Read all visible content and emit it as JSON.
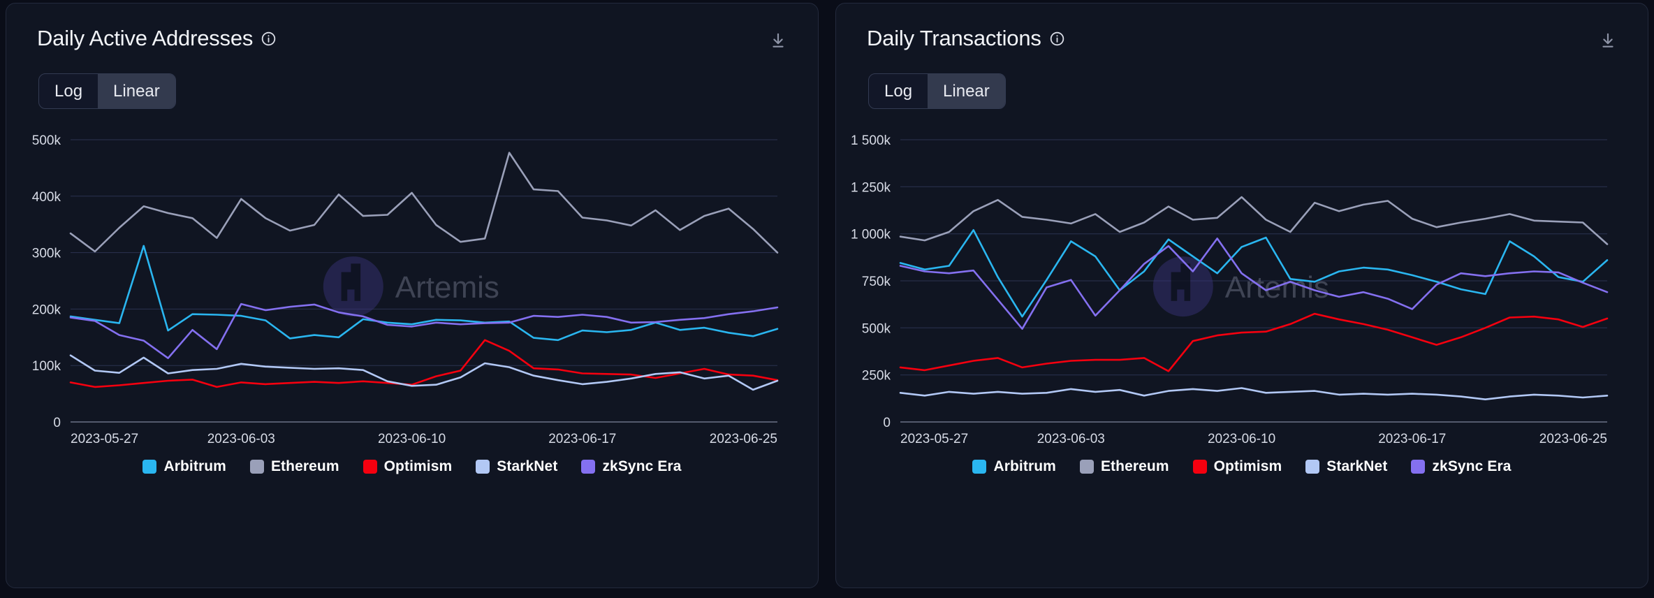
{
  "theme": {
    "page_bg": "#0a0d18",
    "card_bg": "#101522",
    "card_border": "#232a3d",
    "grid": "#2b3350",
    "axis_text": "#d7dbe6",
    "title_text": "#f2f4f8",
    "toggle_active_bg": "#333a4e",
    "watermark_circle": "#3b337a",
    "watermark_text": "#5d6375"
  },
  "watermark": {
    "brand": "Artemis",
    "logo_icon": "artemis-logo-icon"
  },
  "series_colors": {
    "Arbitrum": "#2ab6f0",
    "Ethereum": "#9aa0b9",
    "Optimism": "#f5000f",
    "StarkNet": "#b2c8f5",
    "zkSync Era": "#8470f0"
  },
  "cards": [
    {
      "id": "daily-active-addresses",
      "title": "Daily Active Addresses",
      "info_icon": "info-icon",
      "download_icon": "download-icon",
      "scale_toggle": {
        "options": [
          "Log",
          "Linear"
        ],
        "selected": "Linear"
      },
      "chart_data": {
        "type": "line",
        "title": "Daily Active Addresses",
        "xlabel": "",
        "ylabel": "",
        "grid": true,
        "legend_position": "bottom",
        "ylim": [
          0,
          500000
        ],
        "yticks": [
          0,
          100000,
          200000,
          300000,
          400000,
          500000
        ],
        "ytick_labels": [
          "0",
          "100k",
          "200k",
          "300k",
          "400k",
          "500k"
        ],
        "x": [
          "2023-05-27",
          "2023-05-28",
          "2023-05-29",
          "2023-05-30",
          "2023-05-31",
          "2023-06-01",
          "2023-06-02",
          "2023-06-03",
          "2023-06-04",
          "2023-06-05",
          "2023-06-06",
          "2023-06-07",
          "2023-06-08",
          "2023-06-09",
          "2023-06-10",
          "2023-06-11",
          "2023-06-12",
          "2023-06-13",
          "2023-06-14",
          "2023-06-15",
          "2023-06-16",
          "2023-06-17",
          "2023-06-18",
          "2023-06-19",
          "2023-06-20",
          "2023-06-21",
          "2023-06-22",
          "2023-06-23",
          "2023-06-24",
          "2023-06-25"
        ],
        "xtick_labels": [
          "2023-05-27",
          "2023-06-03",
          "2023-06-10",
          "2023-06-17",
          "2023-06-25"
        ],
        "xtick_indices": [
          0,
          7,
          14,
          21,
          29
        ],
        "series": [
          {
            "name": "Arbitrum",
            "color": "#2ab6f0",
            "values": [
              187000,
              181000,
              175000,
              312000,
              162000,
              191000,
              190000,
              188000,
              180000,
              148000,
              154000,
              150000,
              182000,
              176000,
              173000,
              181000,
              180000,
              176000,
              178000,
              149000,
              145000,
              162000,
              159000,
              163000,
              176000,
              163000,
              167000,
              158000,
              152000,
              165000
            ]
          },
          {
            "name": "Ethereum",
            "color": "#9aa0b9",
            "values": [
              334000,
              302000,
              344000,
              382000,
              370000,
              361000,
              326000,
              395000,
              361000,
              339000,
              349000,
              403000,
              365000,
              367000,
              406000,
              349000,
              319000,
              325000,
              477000,
              412000,
              409000,
              362000,
              357000,
              348000,
              375000,
              340000,
              365000,
              378000,
              342000,
              300000
            ]
          },
          {
            "name": "Optimism",
            "color": "#f5000f",
            "values": [
              70000,
              62000,
              65000,
              69000,
              73000,
              75000,
              62000,
              70000,
              67000,
              69000,
              71000,
              69000,
              72000,
              69000,
              66000,
              81000,
              91000,
              145000,
              126000,
              95000,
              93000,
              86000,
              85000,
              84000,
              78000,
              86000,
              94000,
              84000,
              82000,
              74000
            ]
          },
          {
            "name": "StarkNet",
            "color": "#b2c8f5",
            "values": [
              118000,
              91000,
              87000,
              114000,
              86000,
              92000,
              94000,
              103000,
              98000,
              96000,
              94000,
              95000,
              92000,
              72000,
              64000,
              66000,
              79000,
              104000,
              97000,
              82000,
              74000,
              67000,
              71000,
              77000,
              85000,
              88000,
              77000,
              82000,
              57000,
              73000
            ]
          },
          {
            "name": "zkSync Era",
            "color": "#8470f0",
            "values": [
              185000,
              179000,
              154000,
              144000,
              113000,
              163000,
              129000,
              209000,
              198000,
              204000,
              208000,
              194000,
              187000,
              172000,
              169000,
              176000,
              173000,
              175000,
              176000,
              188000,
              186000,
              190000,
              186000,
              176000,
              177000,
              181000,
              184000,
              191000,
              196000,
              203000
            ]
          }
        ]
      }
    },
    {
      "id": "daily-transactions",
      "title": "Daily Transactions",
      "info_icon": "info-icon",
      "download_icon": "download-icon",
      "scale_toggle": {
        "options": [
          "Log",
          "Linear"
        ],
        "selected": "Linear"
      },
      "chart_data": {
        "type": "line",
        "title": "Daily Transactions",
        "xlabel": "",
        "ylabel": "",
        "grid": true,
        "legend_position": "bottom",
        "ylim": [
          0,
          1500000
        ],
        "yticks": [
          0,
          250000,
          500000,
          750000,
          1000000,
          1250000,
          1500000
        ],
        "ytick_labels": [
          "0",
          "250k",
          "500k",
          "750k",
          "1 000k",
          "1 250k",
          "1 500k"
        ],
        "x": [
          "2023-05-27",
          "2023-05-28",
          "2023-05-29",
          "2023-05-30",
          "2023-05-31",
          "2023-06-01",
          "2023-06-02",
          "2023-06-03",
          "2023-06-04",
          "2023-06-05",
          "2023-06-06",
          "2023-06-07",
          "2023-06-08",
          "2023-06-09",
          "2023-06-10",
          "2023-06-11",
          "2023-06-12",
          "2023-06-13",
          "2023-06-14",
          "2023-06-15",
          "2023-06-16",
          "2023-06-17",
          "2023-06-18",
          "2023-06-19",
          "2023-06-20",
          "2023-06-21",
          "2023-06-22",
          "2023-06-23",
          "2023-06-24",
          "2023-06-25"
        ],
        "xtick_labels": [
          "2023-05-27",
          "2023-06-03",
          "2023-06-10",
          "2023-06-17",
          "2023-06-25"
        ],
        "xtick_indices": [
          0,
          7,
          14,
          21,
          29
        ],
        "series": [
          {
            "name": "Arbitrum",
            "color": "#2ab6f0",
            "values": [
              845000,
              810000,
              830000,
              1020000,
              770000,
              560000,
              755000,
              960000,
              880000,
              700000,
              800000,
              970000,
              880000,
              790000,
              930000,
              980000,
              760000,
              745000,
              800000,
              820000,
              810000,
              780000,
              745000,
              705000,
              680000,
              960000,
              880000,
              770000,
              745000,
              860000
            ]
          },
          {
            "name": "Ethereum",
            "color": "#9aa0b9",
            "values": [
              985000,
              965000,
              1010000,
              1120000,
              1180000,
              1090000,
              1075000,
              1055000,
              1105000,
              1010000,
              1060000,
              1145000,
              1075000,
              1085000,
              1195000,
              1075000,
              1010000,
              1165000,
              1120000,
              1155000,
              1175000,
              1080000,
              1035000,
              1060000,
              1080000,
              1105000,
              1070000,
              1065000,
              1060000,
              945000
            ]
          },
          {
            "name": "Optimism",
            "color": "#f5000f",
            "values": [
              290000,
              275000,
              300000,
              325000,
              340000,
              290000,
              310000,
              325000,
              330000,
              330000,
              340000,
              270000,
              430000,
              460000,
              475000,
              480000,
              520000,
              575000,
              545000,
              520000,
              490000,
              450000,
              410000,
              450000,
              500000,
              555000,
              560000,
              545000,
              505000,
              550000
            ]
          },
          {
            "name": "StarkNet",
            "color": "#b2c8f5",
            "values": [
              155000,
              140000,
              160000,
              150000,
              160000,
              150000,
              155000,
              175000,
              160000,
              170000,
              140000,
              165000,
              175000,
              165000,
              180000,
              155000,
              160000,
              165000,
              145000,
              150000,
              145000,
              150000,
              145000,
              135000,
              120000,
              135000,
              145000,
              140000,
              130000,
              140000
            ]
          },
          {
            "name": "zkSync Era",
            "color": "#8470f0",
            "values": [
              830000,
              800000,
              790000,
              805000,
              650000,
              495000,
              715000,
              755000,
              565000,
              700000,
              840000,
              935000,
              800000,
              975000,
              790000,
              700000,
              745000,
              700000,
              665000,
              690000,
              655000,
              600000,
              730000,
              790000,
              775000,
              790000,
              800000,
              795000,
              740000,
              690000
            ]
          }
        ]
      }
    }
  ]
}
